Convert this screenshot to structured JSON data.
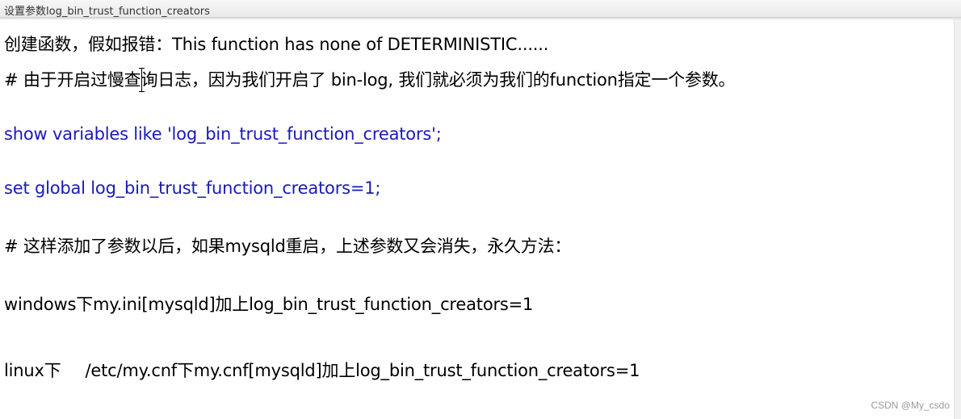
{
  "window": {
    "title": "设置参数log_bin_trust_function_creators"
  },
  "content": {
    "lines": [
      "创建函数，假如报错：This function has none of DETERMINISTIC......",
      "# 由于开启过慢查询日志，因为我们开启了 bin-log, 我们就必须为我们的function指定一个参数。",
      "show variables like 'log_bin_trust_function_creators';",
      "set global log_bin_trust_function_creators=1;",
      "# 这样添加了参数以后，如果mysqld重启，上述参数又会消失，永久方法：",
      "windows下my.ini[mysqld]加上log_bin_trust_function_creators=1"
    ],
    "linux_line": {
      "prefix": "linux下",
      "rest": "/etc/my.cnf下my.cnf[mysqld]加上log_bin_trust_function_creators=1"
    }
  },
  "colors": {
    "text": "#000000",
    "sql_blue": "#1a1ab8"
  },
  "watermark": "CSDN @My_csdo"
}
